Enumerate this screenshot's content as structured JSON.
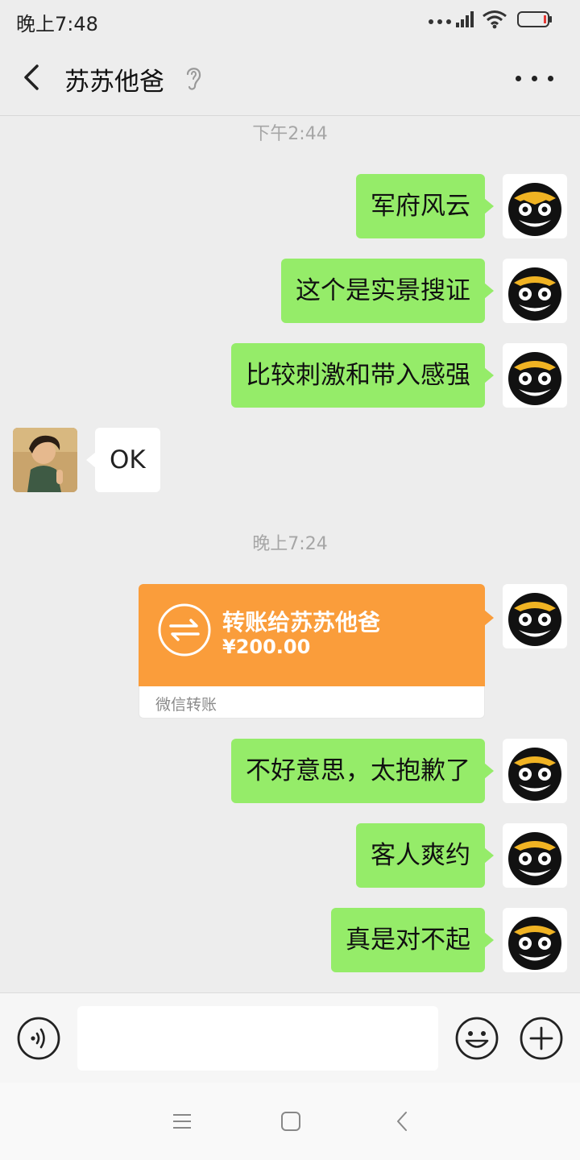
{
  "status_bar": {
    "time": "晚上7:48"
  },
  "header": {
    "title": "苏苏他爸"
  },
  "messages": [
    {
      "type": "timestamp",
      "text": "下午2:44"
    },
    {
      "type": "text",
      "from": "me",
      "text": "军府风云"
    },
    {
      "type": "text",
      "from": "me",
      "text": "这个是实景搜证"
    },
    {
      "type": "text",
      "from": "me",
      "text": "比较刺激和带入感强"
    },
    {
      "type": "text",
      "from": "them",
      "text": "OK"
    },
    {
      "type": "timestamp",
      "text": "晚上7:24"
    },
    {
      "type": "transfer",
      "from": "me",
      "title": "转账给苏苏他爸",
      "amount": "¥200.00",
      "source": "微信转账"
    },
    {
      "type": "text",
      "from": "me",
      "text": "不好意思，太抱歉了"
    },
    {
      "type": "text",
      "from": "me",
      "text": "客人爽约"
    },
    {
      "type": "text",
      "from": "me",
      "text": "真是对不起"
    }
  ],
  "input": {
    "value": ""
  },
  "colors": {
    "my_bubble": "#95ec69",
    "transfer": "#fa9d3b",
    "background": "#ededed"
  },
  "icons": [
    "back-icon",
    "ear-icon",
    "more-icon",
    "voice-icon",
    "emoji-icon",
    "plus-icon",
    "menu-icon",
    "home-icon",
    "back-nav-icon"
  ]
}
